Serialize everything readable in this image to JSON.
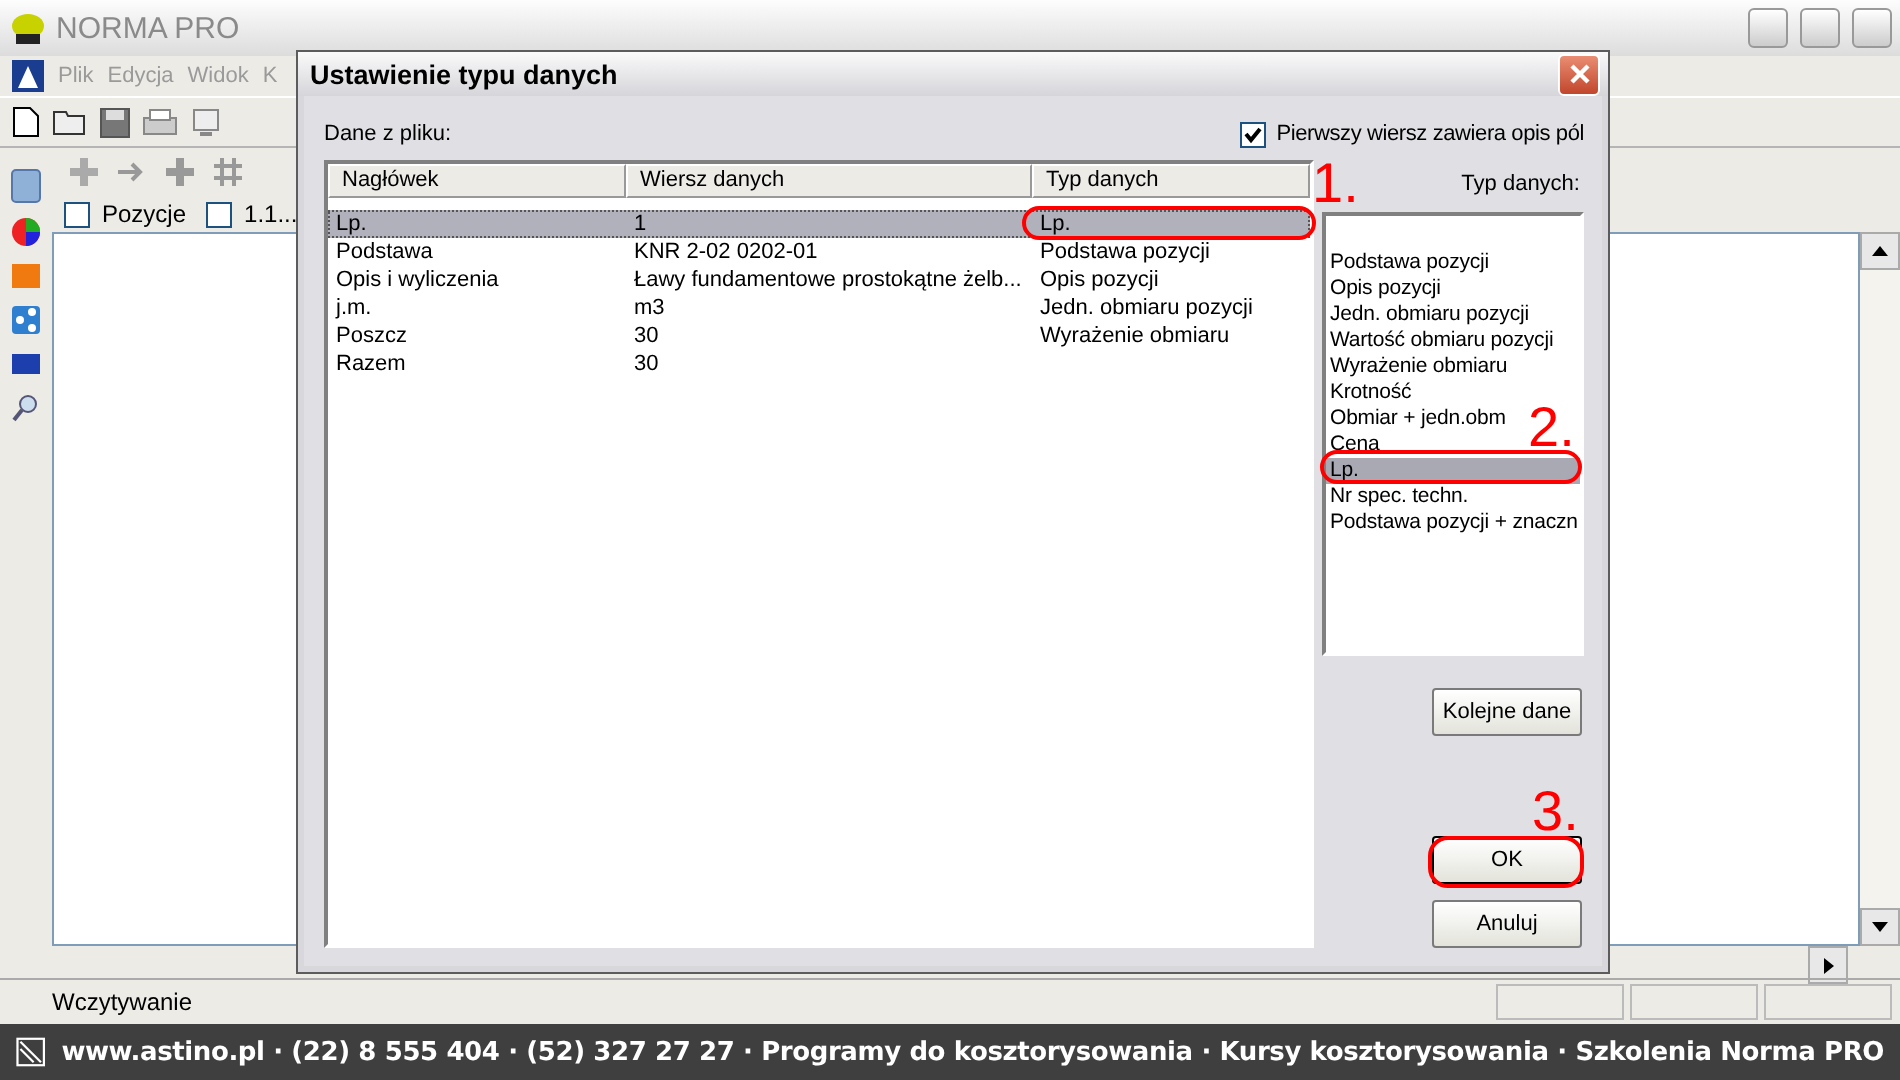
{
  "app": {
    "title": "NORMA PRO",
    "menu": [
      "Plik",
      "Edycja",
      "Widok",
      "K"
    ],
    "checkboxes": [
      {
        "label": "Pozycje",
        "checked": false
      },
      {
        "label": "1.1...",
        "checked": false
      }
    ],
    "status_bar": [
      "Wczytywanie"
    ]
  },
  "dialog": {
    "title": "Ustawienie typu danych",
    "source_label": "Dane z pliku:",
    "header_checkbox": {
      "label": "Pierwszy wiersz zawiera opis pól",
      "checked": true
    },
    "table": {
      "columns": [
        "Nagłówek",
        "Wiersz danych",
        "Typ danych"
      ],
      "rows": [
        {
          "cells": [
            "Lp.",
            "1",
            "Lp."
          ],
          "selected": true
        },
        {
          "cells": [
            "Podstawa",
            "KNR 2-02 0202-01",
            "Podstawa pozycji"
          ],
          "selected": false
        },
        {
          "cells": [
            "Opis i wyliczenia",
            "Ławy fundamentowe prostokątne żelb...",
            "Opis pozycji"
          ],
          "selected": false
        },
        {
          "cells": [
            "j.m.",
            "m3",
            "Jedn. obmiaru pozycji"
          ],
          "selected": false
        },
        {
          "cells": [
            "Poszcz",
            "30",
            "Wyrażenie obmiaru"
          ],
          "selected": false
        },
        {
          "cells": [
            "Razem",
            "30",
            ""
          ],
          "selected": false
        }
      ]
    },
    "types_label": "Typ danych:",
    "types": [
      {
        "label": "Podstawa pozycji",
        "selected": false
      },
      {
        "label": "Opis pozycji",
        "selected": false
      },
      {
        "label": "Jedn. obmiaru pozycji",
        "selected": false
      },
      {
        "label": "Wartość obmiaru pozycji",
        "selected": false
      },
      {
        "label": "Wyrażenie obmiaru",
        "selected": false
      },
      {
        "label": "Krotność",
        "selected": false
      },
      {
        "label": "Obmiar + jedn.obm",
        "selected": false
      },
      {
        "label": "Cena",
        "selected": false
      },
      {
        "label": "Lp.",
        "selected": true
      },
      {
        "label": "Nr spec. techn.",
        "selected": false
      },
      {
        "label": "Podstawa pozycji + znaczn",
        "selected": false
      }
    ],
    "buttons": [
      {
        "label": "Kolejne dane",
        "kind": "next"
      },
      {
        "label": "OK",
        "kind": "default"
      },
      {
        "label": "Anuluj",
        "kind": "cancel"
      }
    ]
  },
  "annotations": [
    {
      "label": "1."
    },
    {
      "label": "2."
    },
    {
      "label": "3."
    }
  ],
  "footer": {
    "text": "www.astino.pl · (22) 8 555 404 · (52) 327 27 27 · Programy do kosztorysowania · Kursy kosztorysowania · Szkolenia Norma PRO"
  }
}
